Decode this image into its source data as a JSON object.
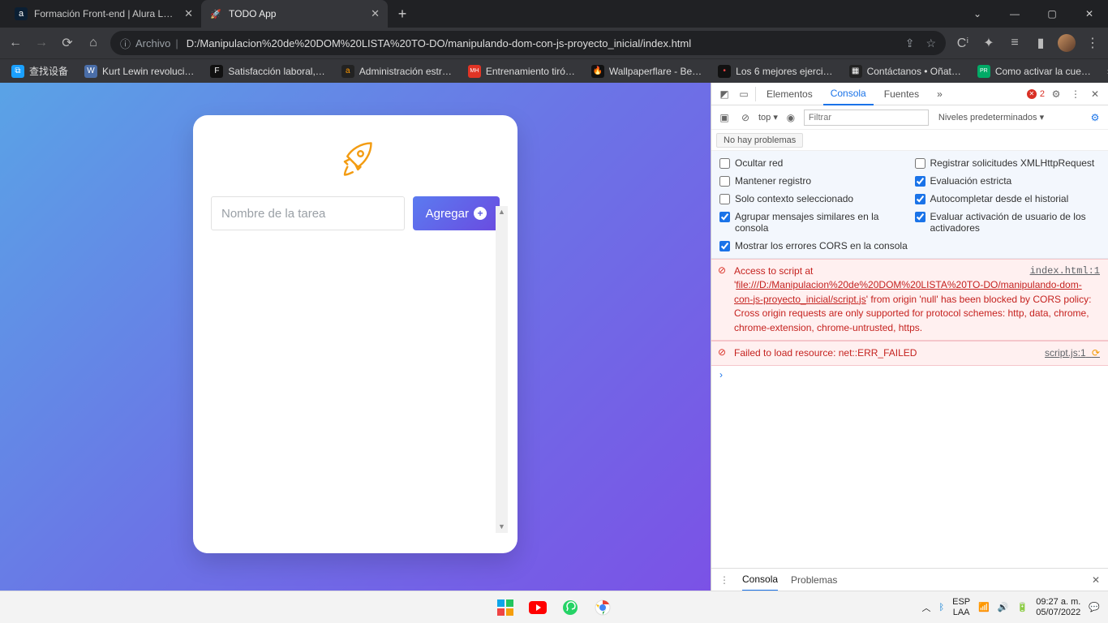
{
  "browser": {
    "tabs": [
      {
        "title": "Formación Front-end | Alura Lata…",
        "favLetter": "a",
        "favBg": "#0b1f33",
        "active": false
      },
      {
        "title": "TODO App",
        "favLetter": "🚀",
        "favBg": "transparent",
        "active": true
      }
    ],
    "windowControls": {
      "dropdown": "⌄",
      "min": "—",
      "max": "▢",
      "close": "✕"
    },
    "nav": {
      "back": "←",
      "forward": "→",
      "reload": "⟳",
      "home": "⌂"
    },
    "omnibox": {
      "scheme_icon": "ⓘ",
      "scheme_label": "Archivo",
      "url": "D:/Manipulacion%20de%20DOM%20LISTA%20TO-DO/manipulando-dom-con-js-proyecto_inicial/index.html",
      "share": "⇪",
      "star": "☆"
    },
    "right_icons": {
      "cast": "Cⁱ",
      "ext": "✦",
      "list": "≡",
      "panel": "▮",
      "menu": "⋮"
    },
    "bookmarks": [
      {
        "label": "查找设备",
        "bg": "#1aa0ff"
      },
      {
        "label": "Kurt Lewin revoluci…",
        "bg": "#4a6ea9",
        "favLetter": "W"
      },
      {
        "label": "Satisfacción laboral,…",
        "bg": "#111",
        "favLetter": "F"
      },
      {
        "label": "Administración estr…",
        "bg": "#222",
        "favLetter": "a"
      },
      {
        "label": "Entrenamiento tiró…",
        "bg": "#e03425",
        "favLetter": "MH"
      },
      {
        "label": "Wallpaperflare - Be…",
        "bg": "#111",
        "favLetter": "🔥"
      },
      {
        "label": "Los 6 mejores ejerci…",
        "bg": "#111",
        "favLetter": "•"
      },
      {
        "label": "Contáctanos • Oñat…",
        "bg": "#222",
        "favLetter": "▦"
      },
      {
        "label": "Como activar la cue…",
        "bg": "#0a6",
        "favLetter": "PR"
      }
    ],
    "bookmarks_more": "»"
  },
  "app": {
    "input_placeholder": "Nombre de la tarea",
    "add_label": "Agregar"
  },
  "devtools": {
    "tabs": {
      "elements": "Elementos",
      "console": "Consola",
      "sources": "Fuentes",
      "more": "»"
    },
    "errbadge": "2",
    "gear": "⚙",
    "close": "✕",
    "dots": "⋮",
    "device": "▥",
    "inspect": "�ododay",
    "row2": {
      "play": "⟳",
      "ban": "⊘",
      "scope": "top ▾",
      "eye": "👁",
      "filter_ph": "Filtrar",
      "levels": "Niveles predeterminados ▾",
      "gear": "⚙"
    },
    "issues_pill": "No hay problemas",
    "checks": {
      "hide_net": "Ocultar red",
      "log_xhr": "Registrar solicitudes XMLHttpRequest",
      "preserve": "Mantener registro",
      "strict": "Evaluación estricta",
      "selected_ctx": "Solo contexto seleccionado",
      "auto_hist": "Autocompletar desde el historial",
      "group": "Agrupar mensajes similares en la consola",
      "user_act": "Evaluar activación de usuario de los activadores",
      "cors": "Mostrar los errores CORS en la consola"
    },
    "errors": [
      {
        "src": "index.html:1",
        "text_pre": "Access to script at '",
        "url": "file:///D:/Manipulacion%20de%20DOM%20LISTA%20TO-DO/manipulando-dom-con-js-proyecto_inicial/script.js",
        "text_post": "' from origin 'null' has been blocked by CORS policy: Cross origin requests are only supported for protocol schemes: http, data, chrome, chrome-extension, chrome-untrusted, https."
      },
      {
        "src": "script.js:1",
        "text_pre": "Failed to load resource: net::ERR_FAILED",
        "url": "",
        "text_post": ""
      }
    ],
    "drawer": {
      "console": "Consola",
      "problems": "Problemas"
    }
  },
  "taskbar": {
    "tray": {
      "chev": "︿",
      "bt": "ᛒ",
      "lang1": "ESP",
      "lang2": "LAA",
      "wifi": "📶",
      "vol": "🔊",
      "bat": "🔋",
      "time": "09:27 a. m.",
      "date": "05/07/2022",
      "bell": "💬"
    }
  }
}
